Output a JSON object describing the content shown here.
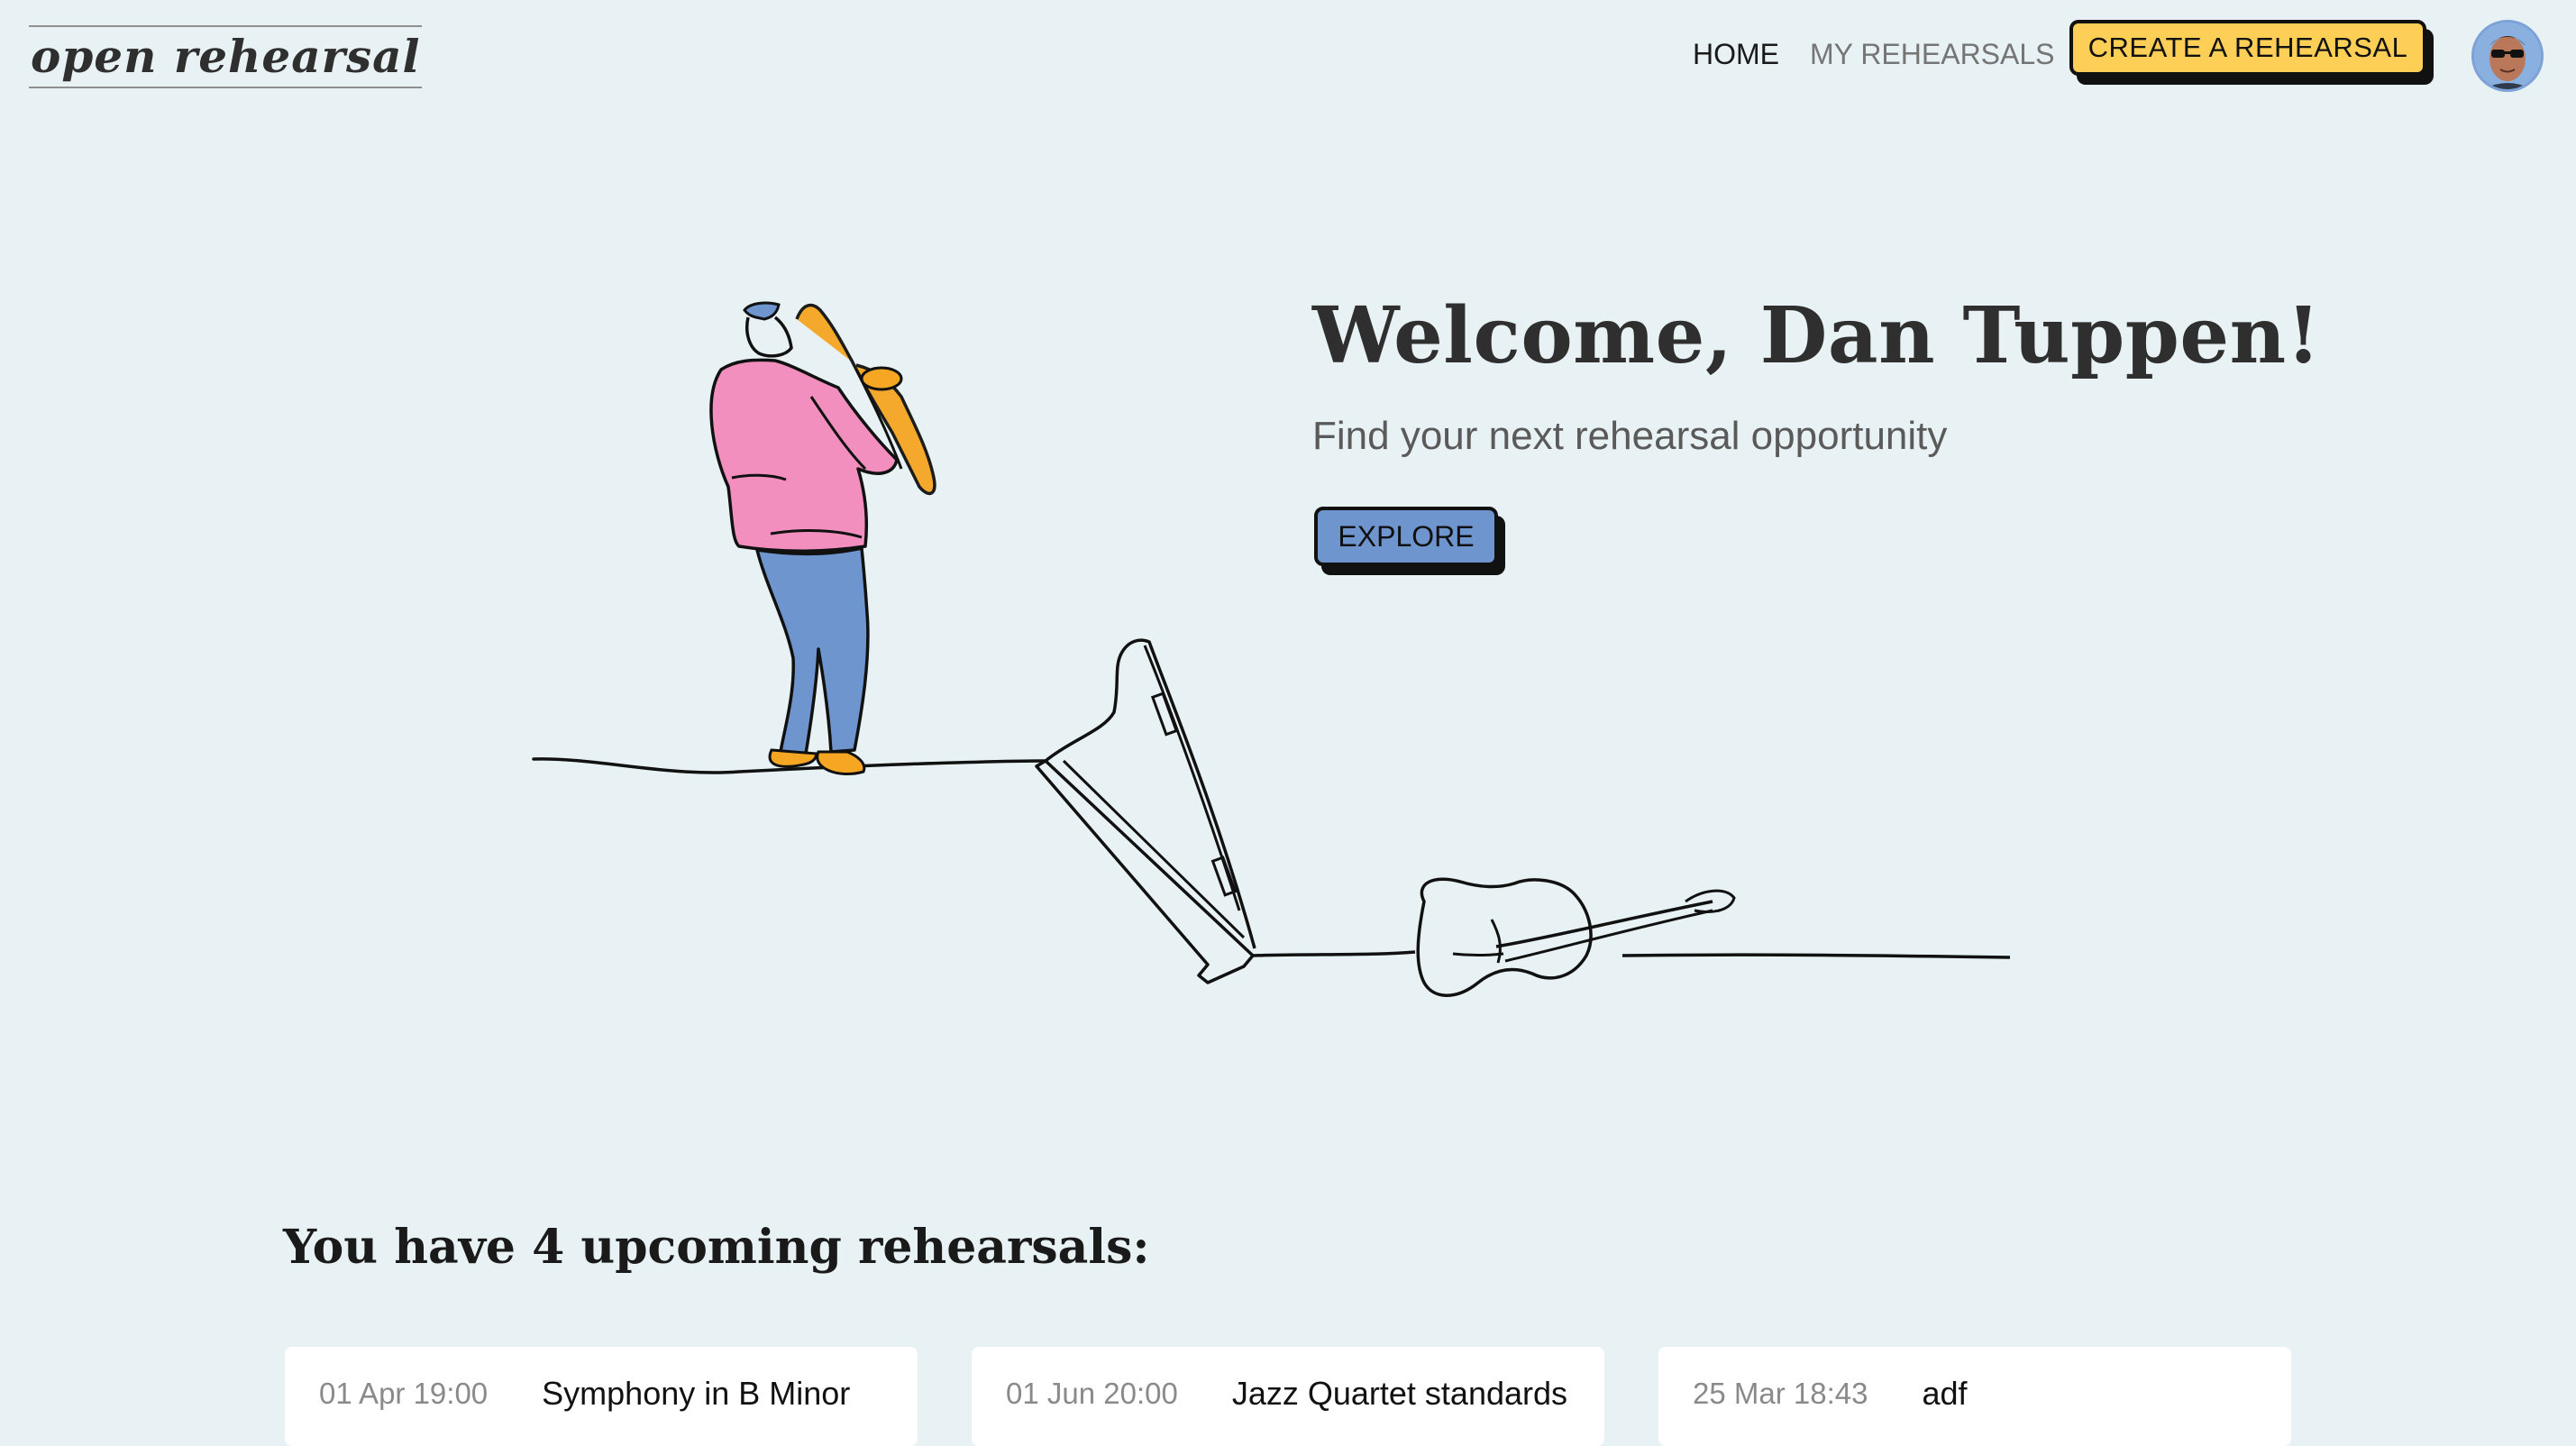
{
  "brand": {
    "logo_text": "open rehearsal"
  },
  "nav": {
    "items": [
      {
        "label": "HOME",
        "active": true
      },
      {
        "label": "MY REHEARSALS",
        "active": false
      }
    ],
    "create_label": "CREATE A REHEARSAL"
  },
  "user": {
    "avatar_icon": "user-avatar-icon"
  },
  "hero": {
    "title": "Welcome, Dan Tuppen!",
    "subtitle": "Find your next rehearsal opportunity",
    "explore_label": "EXPLORE",
    "illustration_icons": [
      "saxophone-player-icon",
      "harp-icon",
      "double-bass-icon"
    ]
  },
  "upcoming": {
    "title": "You have 4 upcoming rehearsals:",
    "cards": [
      {
        "date": "01 Apr 19:00",
        "title": "Symphony in B Minor"
      },
      {
        "date": "01 Jun 20:00",
        "title": "Jazz Quartet standards"
      },
      {
        "date": "25 Mar 18:43",
        "title": "adf"
      }
    ]
  },
  "colors": {
    "background": "#e8f1f3",
    "accent_yellow": "#fdcf56",
    "accent_blue": "#6f95cf",
    "accent_pink": "#f28fbf",
    "accent_orange": "#f5a623"
  }
}
